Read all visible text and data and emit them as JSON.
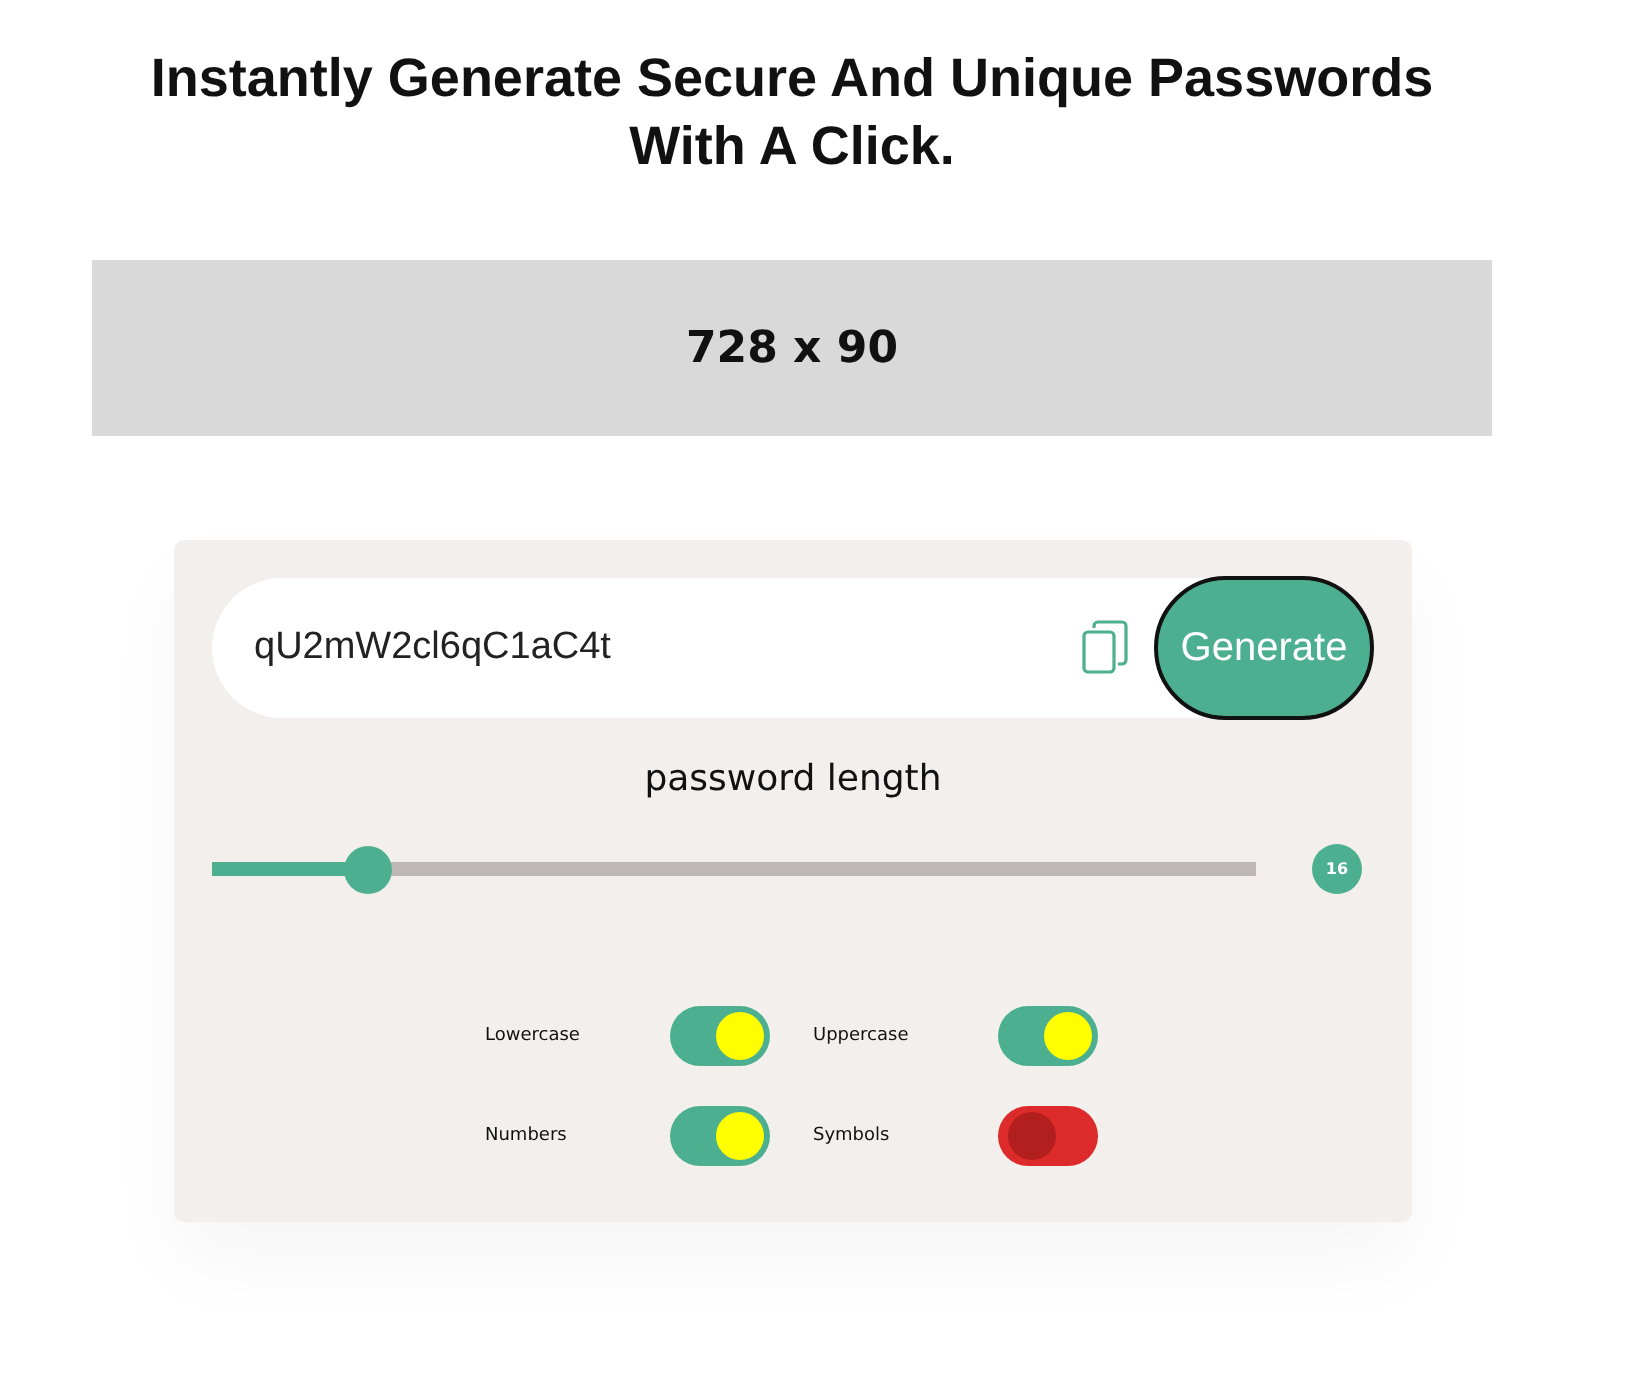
{
  "heading": "Instantly Generate Secure And Unique Passwords With A Click.",
  "ad_banner": {
    "label": "728 x 90"
  },
  "generator": {
    "password": "qU2mW2cl6qC1aC4t",
    "generate_button": "Generate",
    "length_label": "password length",
    "length_slider": {
      "level": 0.15
    },
    "length_value": "16",
    "options": [
      {
        "label": "Lowercase",
        "on": true
      },
      {
        "label": "Uppercase",
        "on": true
      },
      {
        "label": "Numbers",
        "on": true
      },
      {
        "label": "Symbols",
        "on": false
      }
    ]
  }
}
